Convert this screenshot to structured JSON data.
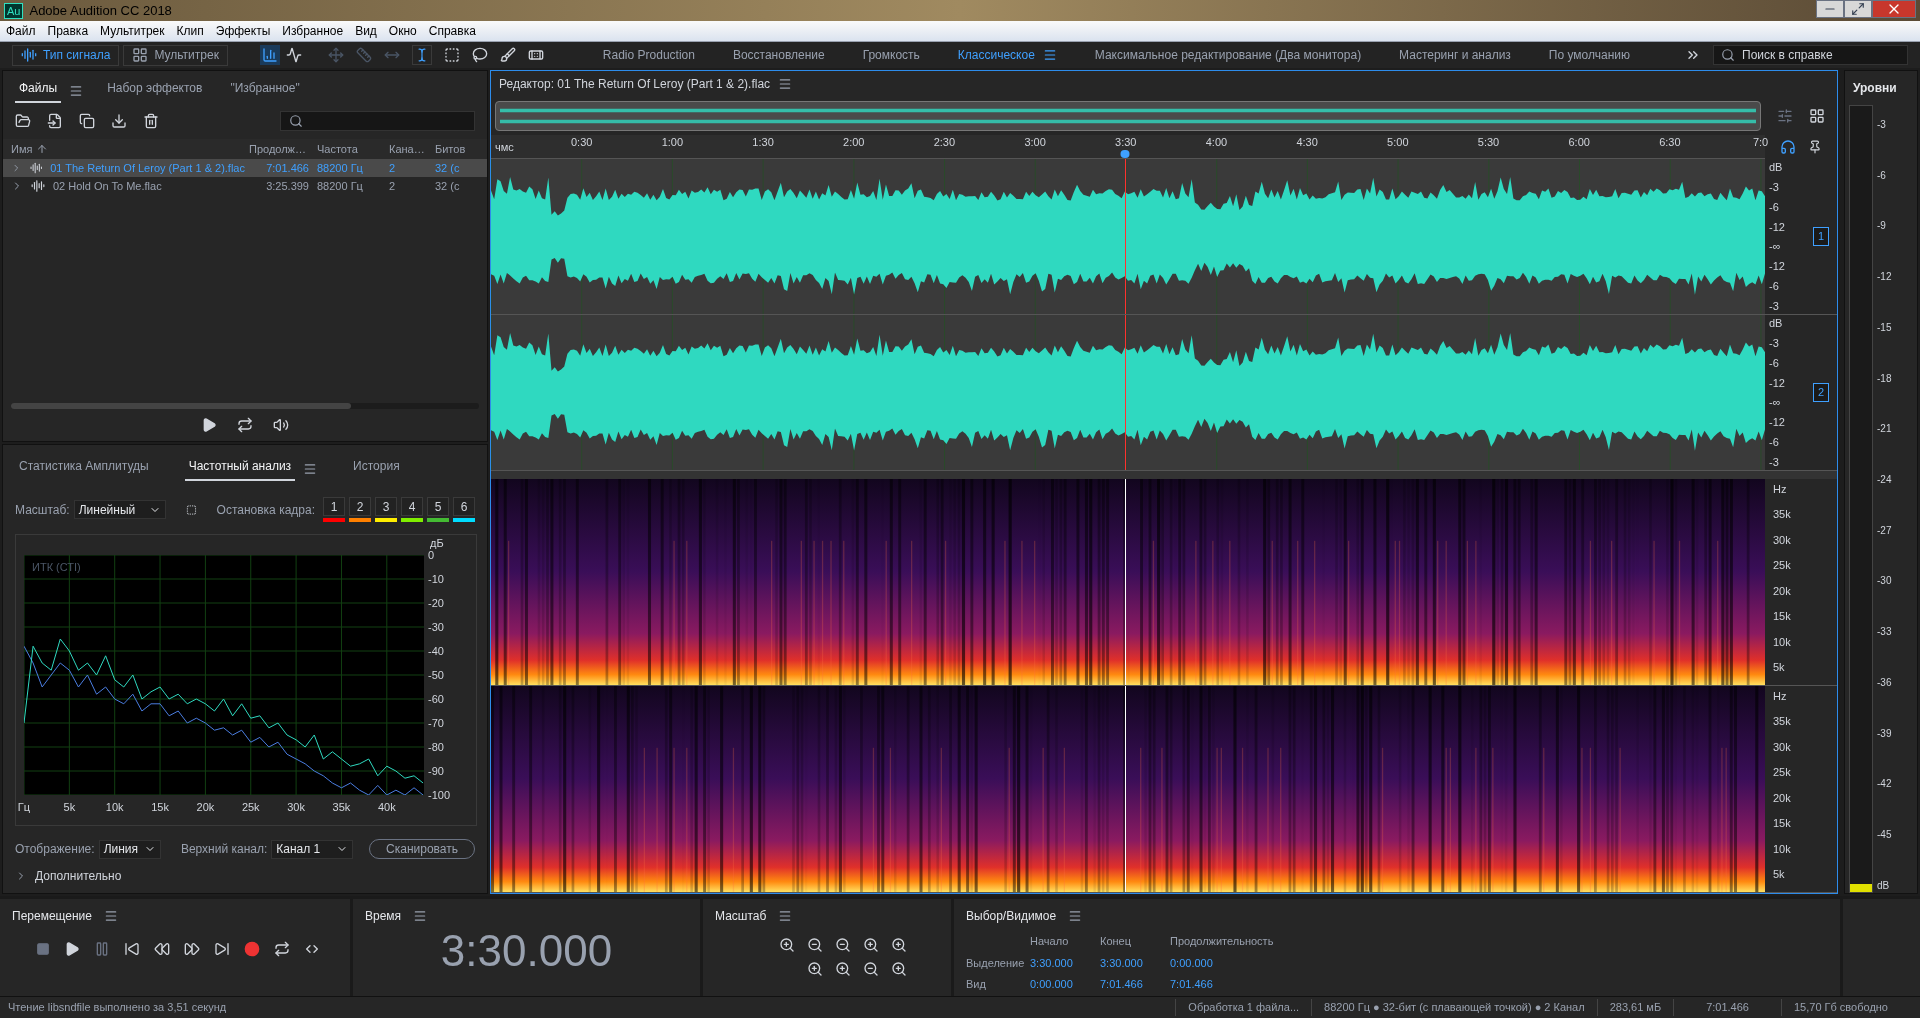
{
  "window": {
    "app_badge": "Au",
    "title": "Adobe Audition CC 2018"
  },
  "menu": [
    "Файл",
    "Правка",
    "Мультитрек",
    "Клип",
    "Эффекты",
    "Избранное",
    "Вид",
    "Окно",
    "Справка"
  ],
  "toolbar": {
    "views": [
      {
        "label": "Тип сигнала",
        "selected": true
      },
      {
        "label": "Мультитрек",
        "selected": false
      }
    ],
    "workspaces": [
      {
        "label": "Radio Production",
        "selected": false
      },
      {
        "label": "Восстановление",
        "selected": false
      },
      {
        "label": "Громкость",
        "selected": false
      },
      {
        "label": "Классическое",
        "selected": true
      },
      {
        "label": "Максимальное редактирование (Два монитора)",
        "selected": false
      },
      {
        "label": "Мастеринг и анализ",
        "selected": false
      },
      {
        "label": "По умолчанию",
        "selected": false
      }
    ],
    "search": {
      "placeholder": "Поиск в справке"
    }
  },
  "files_panel": {
    "tabs": [
      {
        "label": "Файлы",
        "selected": true
      },
      {
        "label": "Набор эффектов",
        "selected": false
      },
      {
        "label": "\"Избранное\"",
        "selected": false
      }
    ],
    "columns": [
      "Имя",
      "Продолж…",
      "Частота",
      "Кана…",
      "Битов"
    ],
    "rows": [
      {
        "name": "01 The Return Of Leroy (Part 1 & 2).flac",
        "duration": "7:01.466",
        "rate": "88200 Гц",
        "channels": "2",
        "bits": "32 (c",
        "selected": true
      },
      {
        "name": "02 Hold On To Me.flac",
        "duration": "3:25.399",
        "rate": "88200 Гц",
        "channels": "2",
        "bits": "32 (c",
        "selected": false
      }
    ]
  },
  "analysis_panel": {
    "tabs": [
      {
        "label": "Статистика Амплитуды",
        "selected": false
      },
      {
        "label": "Частотный анализ",
        "selected": true
      },
      {
        "label": "История",
        "selected": false
      }
    ],
    "scale_label": "Масштаб:",
    "scale_value": "Линейный",
    "freeze_label": "Остановка кадра:",
    "freeze_buttons": [
      {
        "label": "1",
        "color": "#ff0000"
      },
      {
        "label": "2",
        "color": "#ff8000"
      },
      {
        "label": "3",
        "color": "#ffee00"
      },
      {
        "label": "4",
        "color": "#80ee00"
      },
      {
        "label": "5",
        "color": "#44bb33"
      },
      {
        "label": "6",
        "color": "#00ddff"
      }
    ],
    "plot_caption": "ИТК (СТI)",
    "chart_data": {
      "type": "line",
      "ylabel": "дБ",
      "xlim": [
        0,
        44100
      ],
      "ylim": [
        -100,
        0
      ],
      "grid": true,
      "x": [
        0,
        1000,
        2000,
        3000,
        4000,
        5000,
        6000,
        7000,
        8000,
        9000,
        10000,
        11000,
        12000,
        13000,
        14000,
        15000,
        16000,
        17000,
        18000,
        19000,
        20000,
        21000,
        22000,
        23000,
        24000,
        25000,
        26000,
        27000,
        28000,
        29000,
        30000,
        31000,
        32000,
        33000,
        34000,
        35000,
        36000,
        37000,
        38000,
        39000,
        40000,
        41000,
        42000,
        43000,
        44000
      ],
      "series": [
        {
          "color": "#2fd9c0",
          "values": [
            -70,
            -38,
            -45,
            -48,
            -35,
            -40,
            -48,
            -45,
            -50,
            -42,
            -52,
            -55,
            -50,
            -60,
            -57,
            -55,
            -60,
            -58,
            -62,
            -60,
            -62,
            -65,
            -60,
            -67,
            -62,
            -68,
            -67,
            -72,
            -70,
            -75,
            -77,
            -80,
            -75,
            -85,
            -82,
            -85,
            -88,
            -87,
            -85,
            -92,
            -88,
            -90,
            -93,
            -92,
            -95
          ]
        },
        {
          "color": "#4a7de0",
          "values": [
            -38,
            -45,
            -55,
            -50,
            -45,
            -48,
            -55,
            -50,
            -58,
            -55,
            -60,
            -62,
            -58,
            -65,
            -62,
            -62,
            -67,
            -65,
            -70,
            -68,
            -70,
            -73,
            -72,
            -75,
            -73,
            -78,
            -76,
            -80,
            -78,
            -83,
            -85,
            -87,
            -90,
            -92,
            -95,
            -97,
            -95,
            -98,
            -100,
            -96,
            -100,
            -98,
            -100,
            -97,
            -100
          ]
        }
      ],
      "yticks": [
        0,
        -10,
        -20,
        -30,
        -40,
        -50,
        -60,
        -70,
        -80,
        -90,
        -100
      ],
      "xticks": [
        {
          "value": 0,
          "label": "Гц"
        },
        {
          "value": 5000,
          "label": "5k"
        },
        {
          "value": 10000,
          "label": "10k"
        },
        {
          "value": 15000,
          "label": "15k"
        },
        {
          "value": 20000,
          "label": "20k"
        },
        {
          "value": 25000,
          "label": "25k"
        },
        {
          "value": 30000,
          "label": "30k"
        },
        {
          "value": 35000,
          "label": "35k"
        },
        {
          "value": 40000,
          "label": "40k"
        }
      ]
    },
    "display_label": "Отображение:",
    "display_value": "Линия",
    "channel_label": "Верхний канал:",
    "channel_value": "Канал 1",
    "scan_button": "Сканировать",
    "advanced": "Дополнительно"
  },
  "editor": {
    "title": "Редактор: 01 The Return Of Leroy (Part 1 & 2).flac",
    "ruler": {
      "unit": "чмс",
      "labels": [
        "0:30",
        "1:00",
        "1:30",
        "2:00",
        "2:30",
        "3:00",
        "3:30",
        "4:00",
        "4:30",
        "5:00",
        "5:30",
        "6:00",
        "6:30",
        "7:0"
      ]
    },
    "playhead": {
      "level": 0.498
    },
    "channels": [
      {
        "badge": "1",
        "db_labels": [
          "dB",
          "-3",
          "-6",
          "-12",
          "-∞",
          "-12",
          "-6",
          "-3"
        ]
      },
      {
        "badge": "2",
        "db_labels": [
          "dB",
          "-3",
          "-6",
          "-12",
          "-∞",
          "-12",
          "-6",
          "-3"
        ]
      }
    ],
    "spectrograms": [
      {
        "hz_labels": [
          "Hz",
          "35k",
          "30k",
          "25k",
          "20k",
          "15k",
          "10k",
          "5k"
        ]
      },
      {
        "hz_labels": [
          "Hz",
          "35k",
          "30k",
          "25k",
          "20k",
          "15k",
          "10k",
          "5k"
        ]
      }
    ]
  },
  "levels": {
    "title": "Уровни",
    "scale": [
      "-3",
      "-6",
      "-9",
      "-12",
      "-15",
      "-18",
      "-21",
      "-24",
      "-27",
      "-30",
      "-33",
      "-36",
      "-39",
      "-42",
      "-45",
      "dB"
    ],
    "level": 0.01
  },
  "transport": {
    "title": "Перемещение"
  },
  "time": {
    "title": "Время",
    "value": "3:30.000"
  },
  "zoom": {
    "title": "Масштаб"
  },
  "selection": {
    "title": "Выбор/Видимое",
    "columns": [
      "Начало",
      "Конец",
      "Продолжительность"
    ],
    "rows": [
      {
        "label": "Выделение",
        "values": [
          "3:30.000",
          "3:30.000",
          "0:00.000"
        ]
      },
      {
        "label": "Вид",
        "values": [
          "0:00.000",
          "7:01.466",
          "7:01.466"
        ]
      }
    ]
  },
  "status_bar": {
    "message": "Чтение libsndfile выполнено за 3,51 секунд",
    "processing": "Обработка 1 файла...",
    "format": "88200 Гц ● 32-бит (с плавающей точкой) ● 2 Канал",
    "size": "283,61 мБ",
    "duration": "7:01.466",
    "free": "15,70 Гб свободно"
  }
}
